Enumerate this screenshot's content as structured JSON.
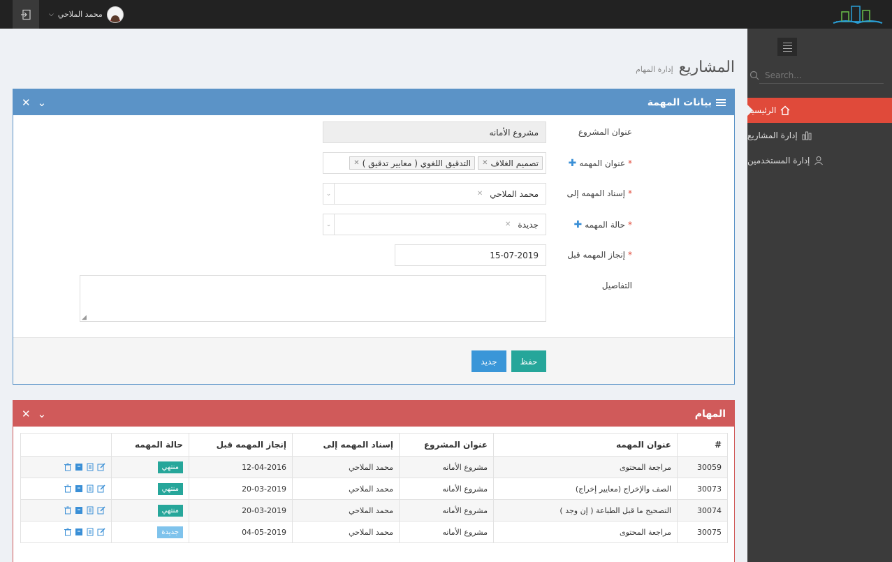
{
  "header": {
    "user_name": "محمد الملاحي",
    "logout_icon": "sign-out-icon"
  },
  "sidebar": {
    "search_placeholder": "Search...",
    "items": [
      {
        "label": "الرئيسية",
        "icon": "home-icon",
        "active": true
      },
      {
        "label": "إدارة المشاريع",
        "icon": "bar-chart-icon",
        "active": false
      },
      {
        "label": "إدارة المستخدمين",
        "icon": "user-icon",
        "active": false
      }
    ]
  },
  "page": {
    "title": "المشاريع",
    "subtitle": "إدارة المهام"
  },
  "form": {
    "panel_title": "بيانات المهمة",
    "project_label": "عنوان المشروع",
    "project_value": "مشروع الأمانه",
    "task_title_label": "عنوان المهمه",
    "task_title_tags": [
      "تصميم الغلاف",
      "التدقيق اللغوي ( معايير تدقيق )"
    ],
    "assignee_label": "إسناد المهمه إلى",
    "assignee_value": "محمد الملاحي",
    "status_label": "حالة المهمه",
    "status_value": "جديدة",
    "due_label": "إنجاز المهمه قبل",
    "due_value": "15-07-2019",
    "details_label": "التفاصيل",
    "required_mark": "*",
    "save_label": "حفظ",
    "new_label": "جديد"
  },
  "tasks": {
    "panel_title": "المهام",
    "columns": [
      "#",
      "عنوان المهمه",
      "عنوان المشروع",
      "إسناد المهمه إلى",
      "إنجاز المهمه قبل",
      "حالة المهمه",
      ""
    ],
    "rows": [
      {
        "id": "30059",
        "title": "مراجعة المحتوى",
        "project": "مشروع الأمانه",
        "assignee": "محمد الملاحي",
        "due": "12-04-2016",
        "status": "منتهي"
      },
      {
        "id": "30073",
        "title": "الصف والإخراج (معايير إخراج)",
        "project": "مشروع الأمانه",
        "assignee": "محمد الملاحي",
        "due": "20-03-2019",
        "status": "منتهي"
      },
      {
        "id": "30074",
        "title": "التصحيح ما قبل الطباعة ( إن وجد )",
        "project": "مشروع الأمانه",
        "assignee": "محمد الملاحي",
        "due": "20-03-2019",
        "status": "منتهي"
      },
      {
        "id": "30075",
        "title": "مراجعة المحتوى",
        "project": "مشروع الأمانه",
        "assignee": "محمد الملاحي",
        "due": "04-05-2019",
        "status": "جديدة"
      }
    ]
  },
  "colors": {
    "accent_red": "#e04a3a",
    "panel_blue": "#5b93c7",
    "panel_red": "#d05a5a",
    "status_done": "#26a69a",
    "status_new": "#7fc3ec"
  }
}
